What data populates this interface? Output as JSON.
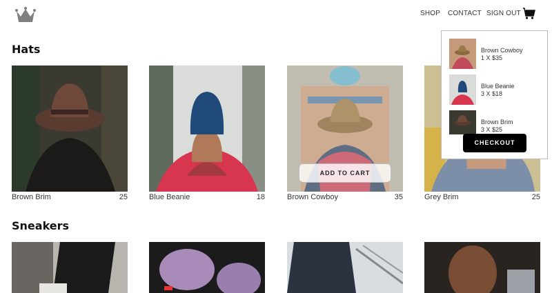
{
  "header": {
    "logo_icon": "crown-icon",
    "nav": [
      {
        "label": "SHOP"
      },
      {
        "label": "CONTACT"
      },
      {
        "label": "SIGN OUT"
      }
    ],
    "cart_icon": "shopping-bag-icon"
  },
  "sections": [
    {
      "title": "Hats",
      "items": [
        {
          "name": "Brown Brim",
          "price": "25"
        },
        {
          "name": "Blue Beanie",
          "price": "18"
        },
        {
          "name": "Brown Cowboy",
          "price": "35"
        },
        {
          "name": "Grey Brim",
          "price": "25"
        }
      ],
      "hover_button": "ADD TO CART"
    },
    {
      "title": "Sneakers",
      "items": []
    }
  ],
  "cart": {
    "items": [
      {
        "name": "Brown Cowboy",
        "qty_price": "1 X $35"
      },
      {
        "name": "Blue Beanie",
        "qty_price": "3 X $18"
      },
      {
        "name": "Brown Brim",
        "qty_price": "3 X $25"
      }
    ],
    "checkout_label": "CHECKOUT"
  },
  "colors": {
    "text": "#333333",
    "checkout_bg": "#000000",
    "logo": "#808080"
  }
}
